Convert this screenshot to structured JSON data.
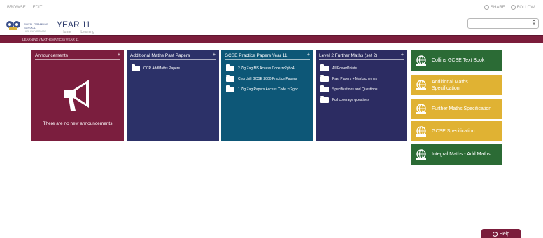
{
  "topbar": {
    "left_links": [
      "BROWSE",
      "EDIT"
    ],
    "right_links": [
      {
        "icon": "share-icon",
        "label": "SHARE"
      },
      {
        "icon": "follow-icon",
        "label": "FOLLOW"
      }
    ]
  },
  "header": {
    "school_name_line1": "ROYAL GRAMMAR SCHOOL",
    "school_name_line2": "HIGH WYCOMBE",
    "title": "YEAR 11",
    "subnav": [
      "Home",
      "Learning"
    ],
    "search_placeholder": ""
  },
  "breadcrumb": "LEARNING / MATHEMATICS / YEAR 11",
  "tiles": {
    "announcements": {
      "title": "Announcements",
      "plus": "+",
      "empty_text": "There are no new announcements"
    },
    "additional_maths": {
      "title": "Additional Maths Past Papers",
      "plus": "+",
      "links": [
        "OCR AddMaths Papers"
      ]
    },
    "gcse_practice": {
      "title": "GCSE Practice Papers Year 11",
      "plus": "+",
      "links": [
        "2 Zig Zag MS Access Code zz2ghc4",
        "Churchill GCSE 2000 Practice Papers",
        "1 Zig Zag Papers Access Code zz2ghc"
      ]
    },
    "level2_further": {
      "title": "Level 2 Further Maths (set 2)",
      "plus": "+",
      "links": [
        "All PowerPoints",
        "Past Papers + Markschemes",
        "Specifications and Questions",
        "Full coverage questions"
      ]
    }
  },
  "link_buttons": [
    {
      "label": "Collins GCSE Text Book",
      "color": "#2b6b35"
    },
    {
      "label": "Additional Maths Specification",
      "color": "#e0b233"
    },
    {
      "label": "Further Maths Specification",
      "color": "#e0b233"
    },
    {
      "label": "GCSE Specification",
      "color": "#e0b233"
    },
    {
      "label": "Integral Maths - Add Maths",
      "color": "#2b6b35"
    }
  ],
  "help": {
    "label": "Help"
  }
}
